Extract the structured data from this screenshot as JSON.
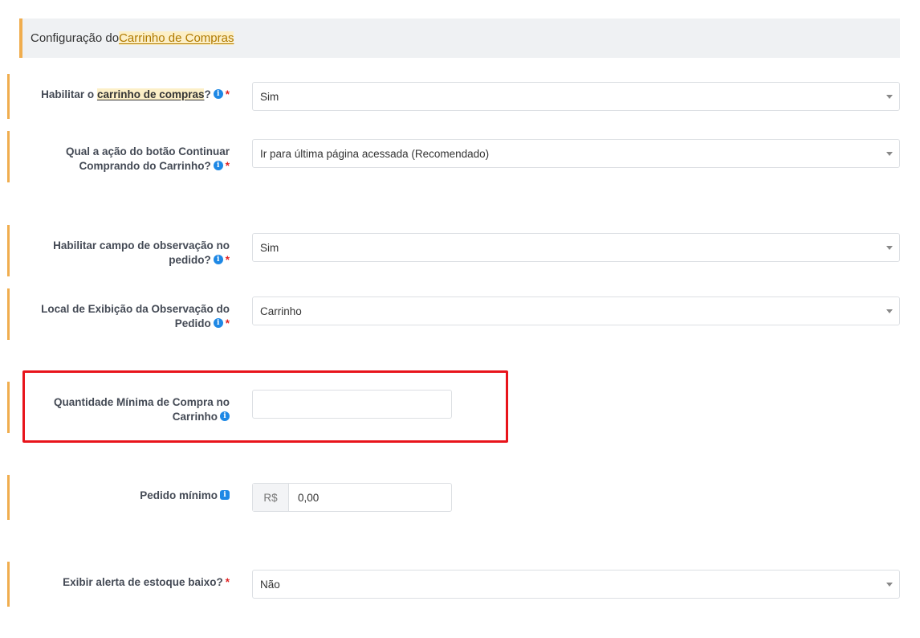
{
  "header": {
    "prefix": "Configuração do ",
    "highlight": "Carrinho de Compras"
  },
  "fields": {
    "cart_enabled": {
      "label_prefix": "Habilitar o ",
      "label_highlight": "carrinho de compras",
      "label_suffix": "?",
      "value": "Sim",
      "required": "*"
    },
    "continue_action": {
      "label_line1": "Qual a ação do botão Continuar",
      "label_line2": "Comprando do Carrinho?",
      "value": "Ir para última página acessada (Recomendado)",
      "required": "*"
    },
    "order_note": {
      "label_line1": "Habilitar campo de observação no",
      "label_line2": "pedido?",
      "value": "Sim",
      "required": "*"
    },
    "note_location": {
      "label_line1": "Local de Exibição da Observação do",
      "label_line2": "Pedido",
      "value": "Carrinho",
      "required": "*"
    },
    "min_quantity": {
      "label_line1": "Quantidade Mínima de Compra no",
      "label_line2": "Carrinho",
      "value": ""
    },
    "min_order": {
      "label": "Pedido mínimo",
      "currency": "R$",
      "value": "0,00"
    },
    "low_stock_alert": {
      "label": "Exibir alerta de estoque baixo?",
      "value": "Não",
      "required": "*"
    }
  },
  "icons": {
    "info": "info-icon",
    "caret": "chevron-down-icon"
  },
  "colors": {
    "accent_bar": "#f0ad4e",
    "info_icon": "#1e88e5",
    "required": "#e02424",
    "highlight_box": "#e8141b"
  }
}
